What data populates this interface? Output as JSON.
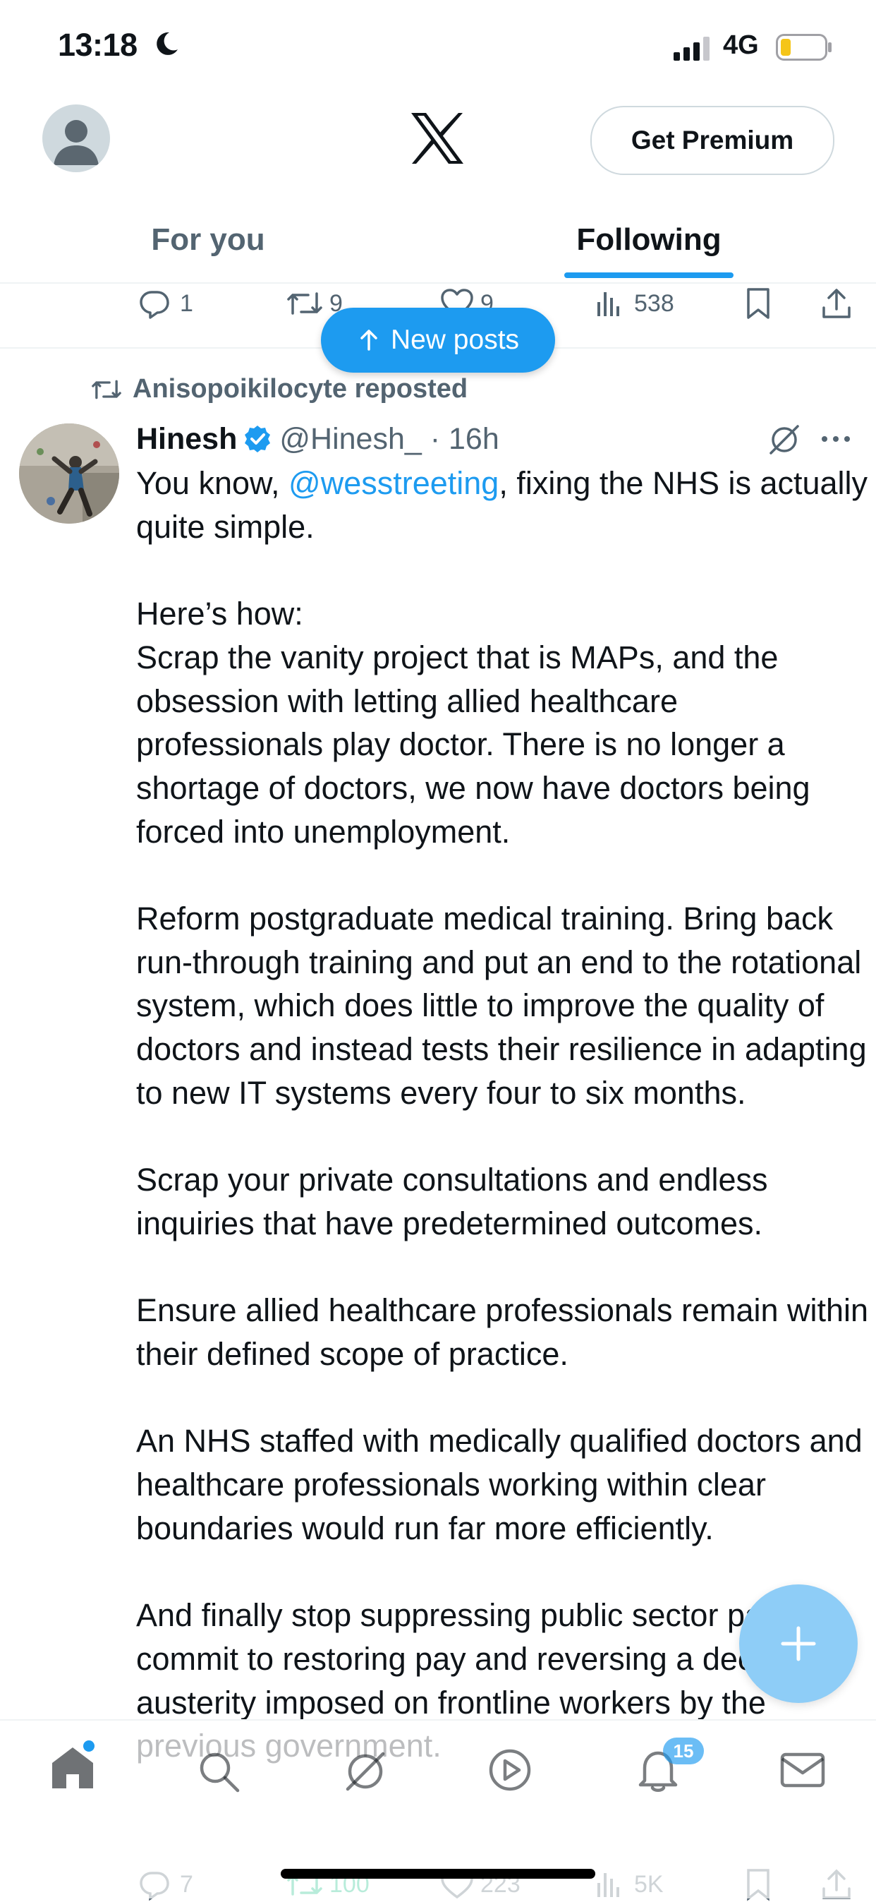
{
  "status_bar": {
    "time": "13:18",
    "network": "4G",
    "icons": [
      "moon-icon",
      "signal-icon",
      "battery-icon"
    ]
  },
  "header": {
    "logo": "x-logo-icon",
    "premium_button": "Get Premium",
    "tabs": [
      {
        "label": "For you",
        "active": false
      },
      {
        "label": "Following",
        "active": true
      }
    ]
  },
  "previous_tweet_actions": {
    "replies": "1",
    "reposts": "9",
    "likes": "9",
    "views": "538"
  },
  "new_posts_pill": {
    "label": "New posts",
    "icon": "arrow-up-icon"
  },
  "tweet": {
    "repost_label": "Anisopoikilocyte reposted",
    "display_name": "Hinesh",
    "verified": true,
    "handle_time": "@Hinesh_ · 16h",
    "text_before_mention": "You know, ",
    "mention": "@wesstreeting",
    "text_after_mention": ", fixing the NHS is actually quite simple.\n\nHere’s how:\nScrap the vanity project that is MAPs, and the obsession with letting allied healthcare professionals play doctor. There is no longer a shortage of doctors, we now have doctors being forced into unemployment.\n\nReform postgraduate medical training. Bring back run-through training and put an end to the rotational system, which does little to improve the quality of doctors and instead tests their resilience in adapting to new IT systems every four to six months.\n\nScrap your private consultations and endless inquiries that have predetermined outcomes.\n\nEnsure allied healthcare professionals remain within their defined scope of practice.\n\nAn NHS staffed with medically qualified doctors and healthcare professionals working within clear boundaries would run far more efficiently.\n\nAnd finally stop suppressing public sector pay, commit to restoring pay and reversing a decade of austerity imposed on frontline workers by the previous government.",
    "actions": {
      "replies": "7",
      "reposts": "100",
      "likes": "223",
      "views": "5K"
    }
  },
  "bottom_nav": {
    "items": [
      "home-icon",
      "search-icon",
      "grok-icon",
      "play-icon",
      "bell-icon",
      "mail-icon"
    ],
    "notification_badge": "15"
  },
  "colors": {
    "accent": "#1d9bf0",
    "text": "#0f1419",
    "secondary": "#536471",
    "repost_green": "#00ba7c"
  }
}
